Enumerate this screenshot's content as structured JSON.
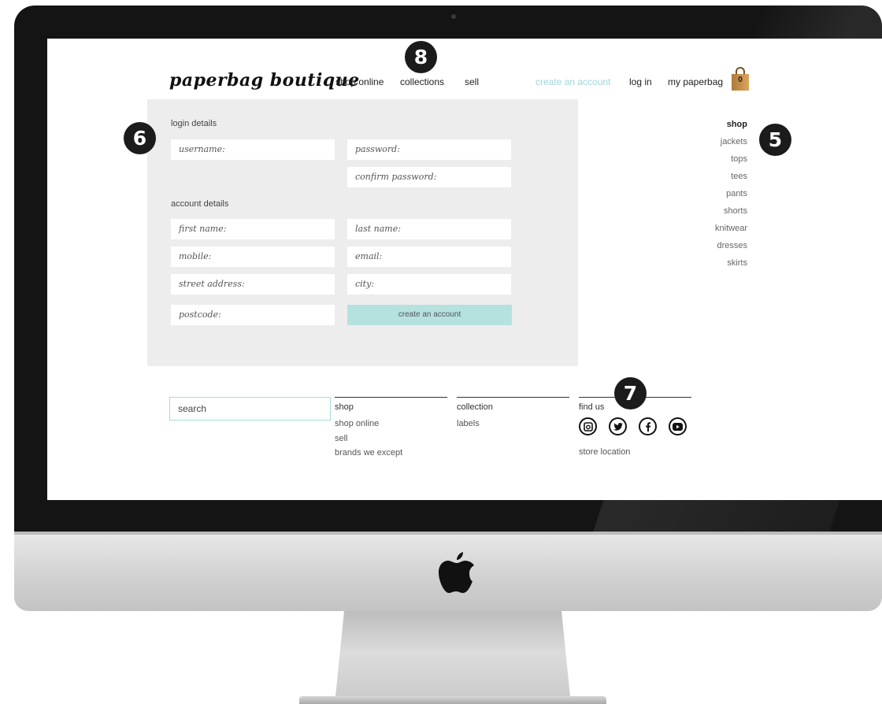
{
  "brand": {
    "logo": "paperbag boutique"
  },
  "nav": {
    "shop_online": "shop online",
    "collections": "collections",
    "sell": "sell",
    "create_account": "create an account",
    "log_in": "log in",
    "my_bag": "my paperbag",
    "bag_count": "0"
  },
  "form": {
    "login_title": "login details",
    "username": "username:",
    "password": "password:",
    "confirm_password": "confirm password:",
    "account_title": "account details",
    "first_name": "first name:",
    "last_name": "last name:",
    "mobile": "mobile:",
    "email": "email:",
    "street": "street address:",
    "city": "city:",
    "postcode": "postcode:",
    "submit": "create an account"
  },
  "sidebar": {
    "title": "shop",
    "items": [
      "jackets",
      "tops",
      "tees",
      "pants",
      "shorts",
      "knitwear",
      "dresses",
      "skirts"
    ]
  },
  "footer": {
    "search_placeholder": "search",
    "shop_title": "shop",
    "shop_links": [
      "shop online",
      "sell",
      "brands we except"
    ],
    "collection_title": "collection",
    "collection_links": [
      "labels"
    ],
    "find_title": "find us",
    "social_icons": [
      "instagram-icon",
      "twitter-icon",
      "facebook-icon",
      "youtube-icon"
    ],
    "store_location": "store location"
  },
  "callouts": {
    "five": "5",
    "six": "6",
    "seven": "7",
    "eight": "8"
  },
  "colors": {
    "accent": "#9fd7da",
    "button": "#b5e2df",
    "panel": "#ededed"
  }
}
